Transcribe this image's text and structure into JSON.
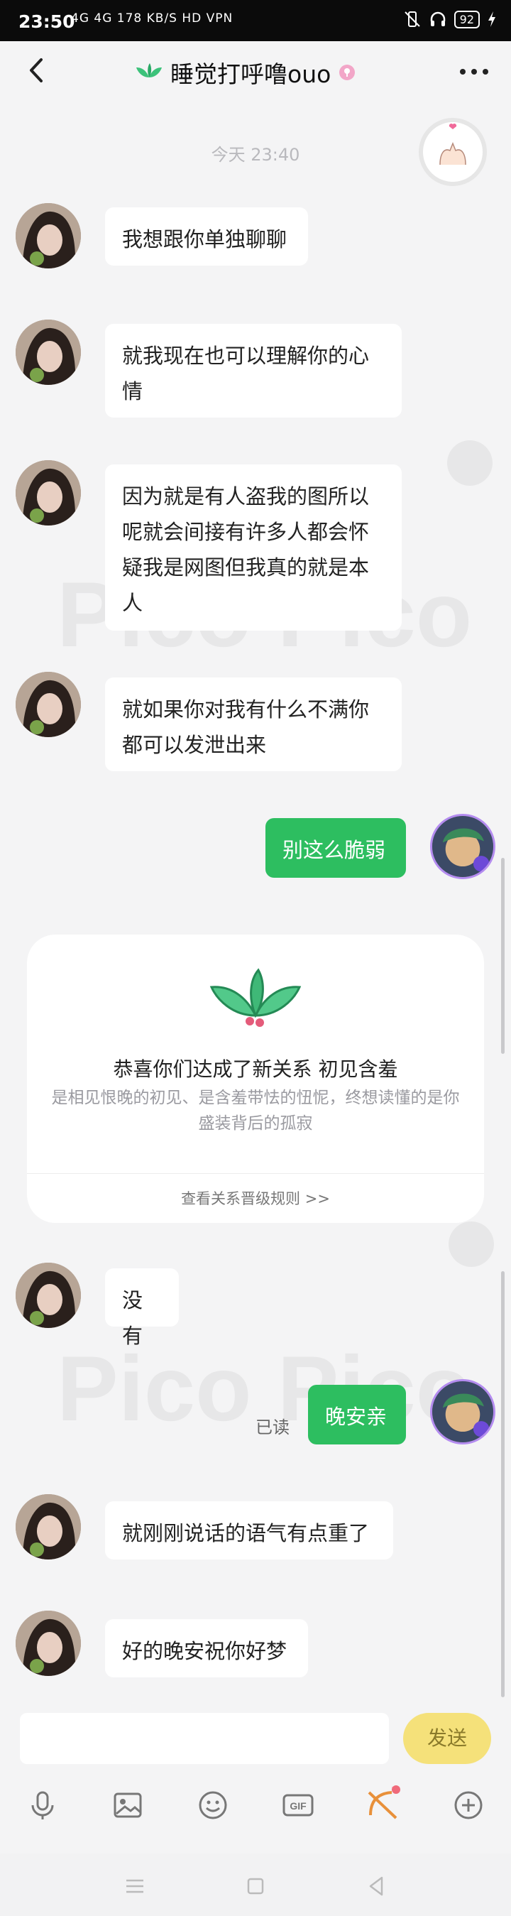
{
  "status_bar": {
    "time": "23:50",
    "network": "4G 4G 178 KB/S HD VPN",
    "battery": "92"
  },
  "header": {
    "title": "睡觉打呼噜ouo",
    "back_icon": "chevron-left-icon",
    "more_icon": "more-dots-icon"
  },
  "chat": {
    "timestamp": "今天 23:40",
    "messages": [
      {
        "side": "left",
        "text": "我想跟你单独聊聊"
      },
      {
        "side": "left",
        "text": "就我现在也可以理解你的心情"
      },
      {
        "side": "left",
        "text": "因为就是有人盗我的图所以呢就会间接有许多人都会怀疑我是网图但我真的就是本人"
      },
      {
        "side": "left",
        "text": "就如果你对我有什么不满你都可以发泄出来"
      },
      {
        "side": "right",
        "text": "别这么脆弱"
      },
      {
        "side": "left",
        "text": "没有"
      },
      {
        "side": "right",
        "text": "晚安亲",
        "read": "已读"
      },
      {
        "side": "left",
        "text": "就刚刚说话的语气有点重了"
      },
      {
        "side": "left",
        "text": "好的晚安祝你好梦"
      }
    ]
  },
  "relation_card": {
    "title": "恭喜你们达成了新关系 初见含羞",
    "description": "是相见恨晚的初见、是含羞带怯的忸怩，终想读懂的是你盛装背后的孤寂",
    "link": "查看关系晋级规则 >>"
  },
  "watermark": "Pico Pico",
  "input": {
    "placeholder": "",
    "send_label": "发送"
  },
  "colors": {
    "my_bubble": "#2dbe60",
    "send_button": "#f5e17a",
    "leaf_green": "#3cc27a"
  }
}
